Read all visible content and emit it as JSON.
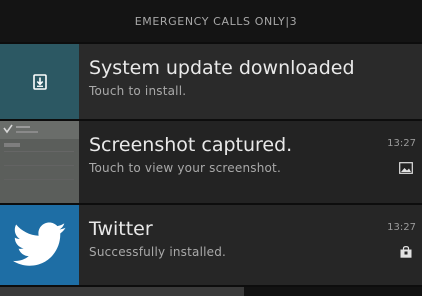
{
  "status_bar": {
    "text": "EMERGENCY CALLS ONLY|3"
  },
  "notifications": [
    {
      "icon": "system-update-icon",
      "title": "System update downloaded",
      "subtitle": "Touch to install.",
      "time": "",
      "small_icon": ""
    },
    {
      "icon": "screenshot-thumbnail",
      "title": "Screenshot captured.",
      "subtitle": "Touch to view your screenshot.",
      "time": "13:27",
      "small_icon": "image-icon"
    },
    {
      "icon": "twitter-bird-icon",
      "title": "Twitter",
      "subtitle": "Successfully installed.",
      "time": "13:27",
      "small_icon": "shopping-bag-icon"
    }
  ],
  "colors": {
    "update_icon_bg": "#2c5863",
    "twitter_icon_bg": "#1e6ea5"
  }
}
